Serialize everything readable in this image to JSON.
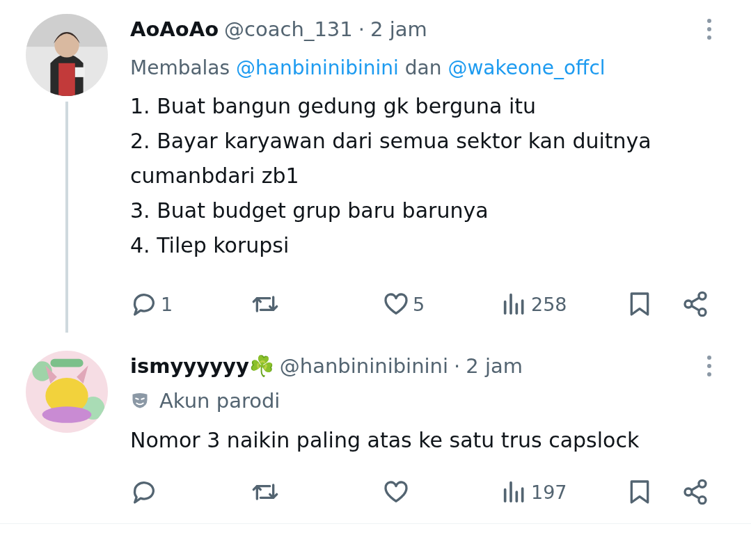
{
  "tweets": [
    {
      "display_name": "AoAoAo",
      "handle": "@coach_131",
      "separator": "·",
      "time": "2 jam",
      "thread_line": true,
      "reply_to": {
        "prefix": "Membalas",
        "users": [
          "@hanbininibinini",
          "@wakeone_offcl"
        ],
        "joiner": "dan"
      },
      "body": [
        "1. Buat bangun gedung gk berguna itu",
        "2. Bayar karyawan dari semua sektor kan duitnya cumanbdari zb1",
        "3. Buat budget grup baru barunya",
        "4. Tilep korupsi"
      ],
      "actions": [
        {
          "kind": "reply",
          "count": "1"
        },
        {
          "kind": "repost"
        },
        {
          "kind": "like",
          "count": "5"
        },
        {
          "kind": "views",
          "count": "258"
        },
        {
          "kind": "bookmark"
        },
        {
          "kind": "share"
        }
      ]
    },
    {
      "display_name": "ismyyyyyy☘️",
      "handle": "@hanbininibinini",
      "separator": "·",
      "time": "2 jam",
      "thread_line": false,
      "label": "Akun parodi",
      "body": [
        "Nomor 3 naikin paling atas ke satu trus capslock"
      ],
      "actions": [
        {
          "kind": "reply"
        },
        {
          "kind": "repost"
        },
        {
          "kind": "like"
        },
        {
          "kind": "views",
          "count": "197"
        },
        {
          "kind": "bookmark"
        },
        {
          "kind": "share"
        }
      ]
    }
  ]
}
